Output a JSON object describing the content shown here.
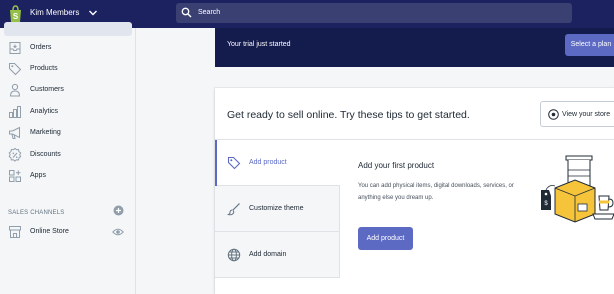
{
  "topbar": {
    "store_name": "Kim Members",
    "search_placeholder": "Search",
    "icons": {
      "logo": "shopify-bag-icon",
      "chevron": "chevron-down-icon",
      "search": "search-icon"
    }
  },
  "sidebar": {
    "items": [
      {
        "label": "Orders",
        "icon": "orders-icon"
      },
      {
        "label": "Products",
        "icon": "tag-icon"
      },
      {
        "label": "Customers",
        "icon": "person-icon"
      },
      {
        "label": "Analytics",
        "icon": "bar-chart-icon"
      },
      {
        "label": "Marketing",
        "icon": "megaphone-icon"
      },
      {
        "label": "Discounts",
        "icon": "discount-icon"
      },
      {
        "label": "Apps",
        "icon": "apps-icon"
      }
    ],
    "sales_channels_title": "SALES CHANNELS",
    "channels": [
      {
        "label": "Online Store",
        "icon": "store-icon"
      }
    ]
  },
  "banner": {
    "text": "Your trial just started",
    "button": "Select a plan"
  },
  "setup_card": {
    "title": "Get ready to sell online. Try these tips to get started.",
    "view_store_button": "View your store",
    "tabs": [
      {
        "label": "Add product",
        "icon": "tag-icon",
        "active": true
      },
      {
        "label": "Customize theme",
        "icon": "brush-icon",
        "active": false
      },
      {
        "label": "Add domain",
        "icon": "globe-icon",
        "active": false
      }
    ],
    "detail": {
      "title": "Add your first product",
      "text": "You can add physical items, digital downloads, services, or anything else you dream up.",
      "button": "Add product"
    }
  },
  "colors": {
    "topbar": "#1c2260",
    "banner": "#141b4d",
    "accent": "#5c6ac4",
    "illustration_yellow": "#f5c43a"
  }
}
